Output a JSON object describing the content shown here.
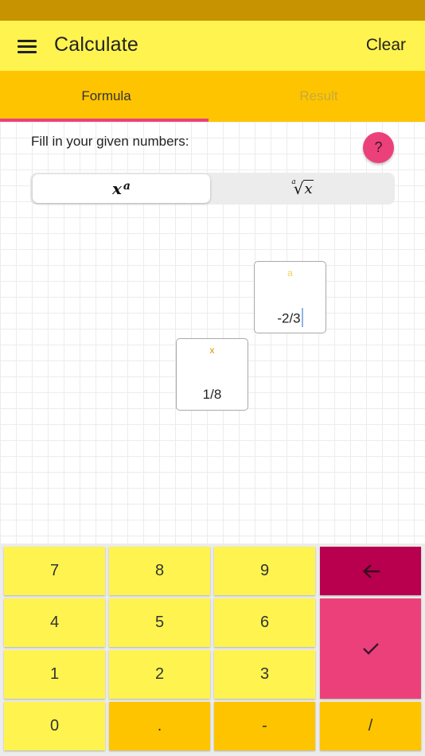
{
  "app": {
    "title": "Calculate",
    "clear_label": "Clear"
  },
  "tabs": [
    {
      "label": "Formula",
      "active": true
    },
    {
      "label": "Result",
      "active": false
    }
  ],
  "formula": {
    "instruction": "Fill in your given numbers:",
    "help_label": "?",
    "modes": {
      "power": {
        "base": "x",
        "exponent": "a",
        "selected": true
      },
      "root": {
        "index": "a",
        "radicand": "x",
        "selected": false
      }
    },
    "inputs": {
      "a": {
        "label": "a",
        "value": "-2/3",
        "focused": true
      },
      "x": {
        "label": "x",
        "value": "1/8",
        "focused": false
      }
    }
  },
  "keypad": {
    "keys": [
      "7",
      "8",
      "9",
      "4",
      "5",
      "6",
      "1",
      "2",
      "3",
      "0",
      ".",
      "-",
      "/"
    ],
    "backspace_icon": "backspace-arrow-icon",
    "confirm_icon": "check-icon"
  },
  "colors": {
    "status_bar": "#c79300",
    "app_bar": "#fff44f",
    "tabs": "#ffc400",
    "accent": "#ec407a",
    "backspace": "#b8004f"
  }
}
